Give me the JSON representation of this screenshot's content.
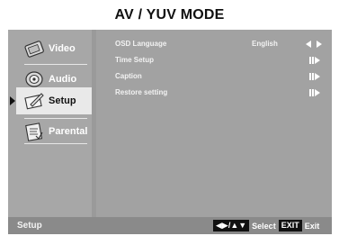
{
  "page": {
    "title": "AV / YUV MODE"
  },
  "sidebar": {
    "items": [
      {
        "label": "Video",
        "icon": "video-icon",
        "active": false
      },
      {
        "label": "Audio",
        "icon": "audio-icon",
        "active": false
      },
      {
        "label": "Setup",
        "icon": "setup-icon",
        "active": true
      },
      {
        "label": "Parental",
        "icon": "parental-icon",
        "active": false
      }
    ]
  },
  "menu": {
    "rows": [
      {
        "label": "OSD Language",
        "value": "English",
        "control": "left-right-arrows-icon"
      },
      {
        "label": "Time Setup",
        "value": "",
        "control": "enter-arrow-icon"
      },
      {
        "label": "Caption",
        "value": "",
        "control": "enter-arrow-icon"
      },
      {
        "label": "Restore setting",
        "value": "",
        "control": "enter-arrow-icon"
      }
    ]
  },
  "footer": {
    "section": "Setup",
    "nav_keys": "◀▶/▲▼",
    "select_text": "Select",
    "exit_key": "EXIT",
    "exit_text": "Exit"
  }
}
